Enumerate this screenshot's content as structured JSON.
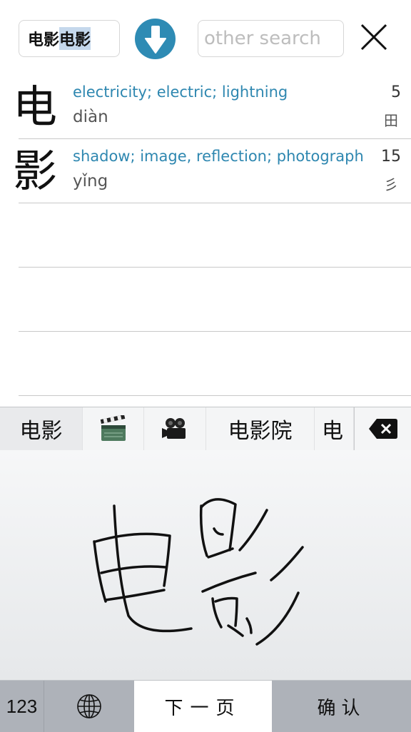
{
  "header": {
    "search_value_plain": "电影",
    "search_value_selected": "电影",
    "other_search_placeholder": "other search",
    "accent_color": "#2e8bb4"
  },
  "results": [
    {
      "character": "电",
      "definition": "electricity; electric; lightning",
      "pinyin": "diàn",
      "strokes": "5",
      "radical": "田"
    },
    {
      "character": "影",
      "definition": "shadow; image, reflection; photograph",
      "pinyin": "yǐng",
      "strokes": "15",
      "radical": "彡"
    }
  ],
  "keyboard": {
    "candidates": [
      {
        "label": "电影",
        "type": "text"
      },
      {
        "label": "clapper-board-emoji",
        "type": "icon"
      },
      {
        "label": "movie-camera-emoji",
        "type": "icon"
      },
      {
        "label": "电影院",
        "type": "text"
      },
      {
        "label": "电",
        "type": "text"
      }
    ],
    "handwriting_strokes_for": "电影",
    "keys": {
      "numbers": "123",
      "globe": "globe-icon",
      "next_page": "下一页",
      "confirm": "确认"
    }
  }
}
